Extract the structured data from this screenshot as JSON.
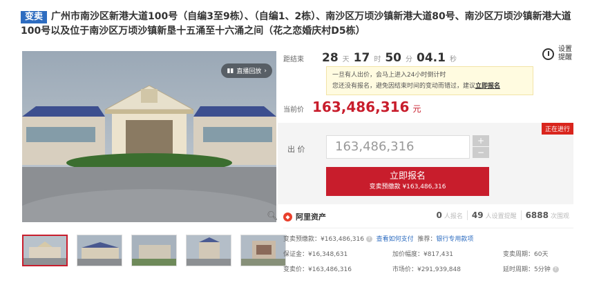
{
  "title": {
    "tag": "变卖",
    "text": "广州市南沙区新港大道100号（自编3至9栋）、（自编1、2栋）、南沙区万顷沙镇新港大道80号、南沙区万顷沙镇新港大道100号以及位于南沙区万顷沙镇新垦十五涌至十六涌之间（花之恋婚庆村D5栋）"
  },
  "gallery": {
    "live_label": "直播回放",
    "live_icon": "bar-chart-icon",
    "zoom_icon": "magnifier-icon",
    "thumbnail_count": 5
  },
  "countdown": {
    "label": "距结束",
    "days": "28",
    "days_unit": "天",
    "hours": "17",
    "hours_unit": "时",
    "minutes": "50",
    "minutes_unit": "分",
    "seconds": "04.1",
    "seconds_unit": "秒"
  },
  "remind": {
    "line1": "设置",
    "line2": "提醒",
    "icon": "alarm-clock-icon"
  },
  "notice": {
    "line1": "一旦有人出价，会马上进入24小时倒计时",
    "line2": "您还没有报名，避免因结束时间的变动而错过，建议",
    "link": "立即报名"
  },
  "current": {
    "label": "当前价",
    "price": "163,486,316",
    "unit": "元"
  },
  "bid": {
    "status": "正在进行",
    "label": "出  价",
    "value": "163,486,316",
    "plus": "+",
    "minus": "−",
    "button_line1": "立即报名",
    "button_line2": "变卖预缴款 ¥163,486,316"
  },
  "brand": {
    "name": "阿里资产",
    "signups_count": "0",
    "signups_label": "人报名",
    "reminders_count": "49",
    "reminders_label": "人设置提醒",
    "views_count": "6888",
    "views_label": "次围观"
  },
  "info": {
    "deposit": "变卖预缴款：¥163,486,316",
    "how_to_pay": "查看如何支付",
    "recommend_label": "推荐：",
    "recommend_link": "银行专用款项",
    "guarantee": "保证金：¥16,348,631",
    "increment": "加价幅度：¥817,431",
    "period": "变卖周期：60天",
    "sale_price": "变卖价：¥163,486,316",
    "market_price": "市场价：¥291,939,848",
    "delay": "延时周期：5分钟"
  },
  "colors": {
    "accent": "#c81d2c",
    "tag": "#2d6cc0",
    "status": "#d9251d"
  }
}
